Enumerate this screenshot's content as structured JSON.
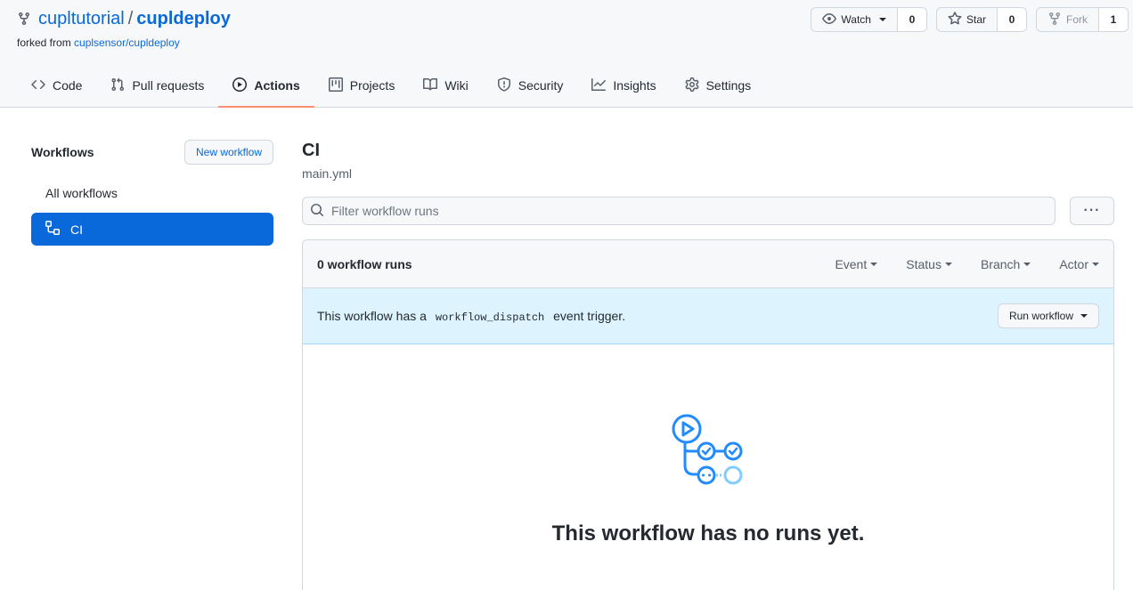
{
  "repo": {
    "owner": "cupltutorial",
    "separator": "/",
    "name": "cupldeploy",
    "forked_from_label": "forked from",
    "forked_from_link": "cuplsensor/cupldeploy"
  },
  "actions": {
    "watch": {
      "label": "Watch",
      "count": "0"
    },
    "star": {
      "label": "Star",
      "count": "0"
    },
    "fork": {
      "label": "Fork",
      "count": "1"
    }
  },
  "nav": {
    "items": [
      {
        "label": "Code",
        "icon": "code-icon"
      },
      {
        "label": "Pull requests",
        "icon": "git-pull-request-icon"
      },
      {
        "label": "Actions",
        "icon": "play-icon",
        "selected": true
      },
      {
        "label": "Projects",
        "icon": "table-icon"
      },
      {
        "label": "Wiki",
        "icon": "book-icon"
      },
      {
        "label": "Security",
        "icon": "shield-icon"
      },
      {
        "label": "Insights",
        "icon": "graph-icon"
      },
      {
        "label": "Settings",
        "icon": "gear-icon"
      }
    ]
  },
  "sidebar": {
    "title": "Workflows",
    "new_workflow": "New workflow",
    "items": [
      {
        "label": "All workflows"
      },
      {
        "label": "CI",
        "active": true,
        "icon": "workflow-icon"
      }
    ]
  },
  "workflow": {
    "title": "CI",
    "file": "main.yml",
    "filter_placeholder": "Filter workflow runs",
    "more_label": "···"
  },
  "runs": {
    "count_label": "0 workflow runs",
    "filters": [
      "Event",
      "Status",
      "Branch",
      "Actor"
    ],
    "dispatch_prefix": "This workflow has a",
    "dispatch_code": "workflow_dispatch",
    "dispatch_suffix": "event trigger.",
    "run_button": "Run workflow",
    "empty_title": "This workflow has no runs yet."
  },
  "colors": {
    "accent": "#0969da",
    "nav_underline": "#fd8c73",
    "dispatch_bg": "#ddf4ff"
  }
}
